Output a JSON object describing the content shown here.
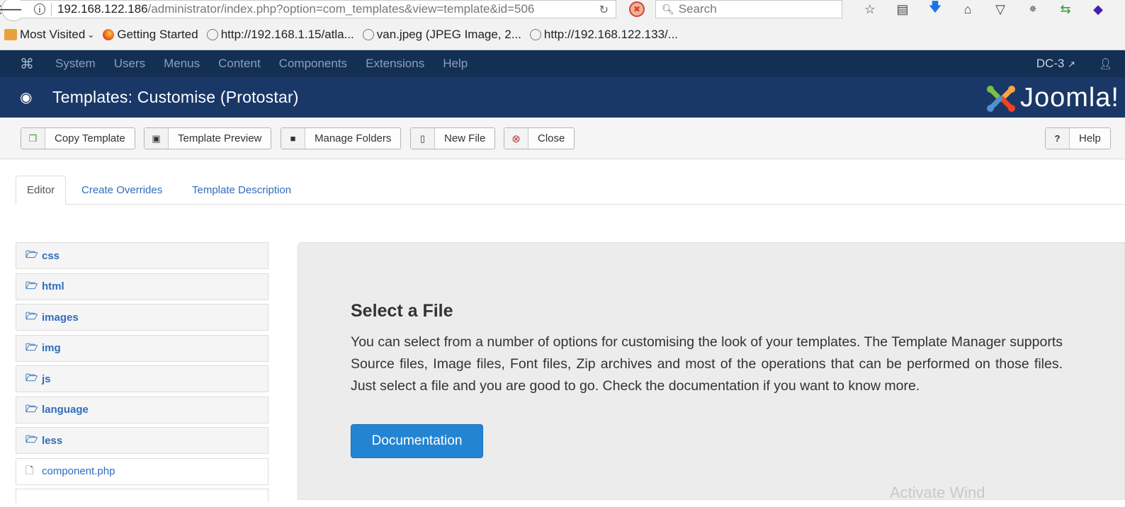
{
  "browser": {
    "url_host": "192.168.122.186",
    "url_path": "/administrator/index.php?option=com_templates&view=template&id=506",
    "search_placeholder": "Search",
    "bookmarks": [
      {
        "label": "Most Visited",
        "icon": "folder-icon"
      },
      {
        "label": "Getting Started",
        "icon": "firefox-icon"
      },
      {
        "label": "http://192.168.1.15/atla...",
        "icon": "globe-icon"
      },
      {
        "label": "van.jpeg (JPEG Image, 2...",
        "icon": "globe-icon"
      },
      {
        "label": "http://192.168.122.133/...",
        "icon": "globe-icon"
      }
    ]
  },
  "topnav": {
    "items": [
      "System",
      "Users",
      "Menus",
      "Content",
      "Components",
      "Extensions",
      "Help"
    ],
    "site_name": "DC-3"
  },
  "header": {
    "title": "Templates: Customise (Protostar)",
    "logo_text": "Joomla!"
  },
  "toolbar": {
    "copy_template": "Copy Template",
    "template_preview": "Template Preview",
    "manage_folders": "Manage Folders",
    "new_file": "New File",
    "close": "Close",
    "help": "Help"
  },
  "tabs": {
    "editor": "Editor",
    "create_overrides": "Create Overrides",
    "template_description": "Template Description"
  },
  "tree": {
    "folders": [
      "css",
      "html",
      "images",
      "img",
      "js",
      "language",
      "less"
    ],
    "files": [
      "component.php"
    ]
  },
  "panel": {
    "title": "Select a File",
    "description": "You can select from a number of options for customising the look of your templates. The Template Manager supports Source files, Image files, Font files, Zip archives and most of the operations that can be performed on those files. Just select a file and you are good to go. Check the documentation if you want to know more.",
    "button": "Documentation",
    "watermark": "Activate Wind"
  },
  "colors": {
    "topnav_bg": "#132f53",
    "subhead_bg": "#1a3867",
    "link": "#2f6dbd",
    "primary_button": "#2384d3"
  }
}
